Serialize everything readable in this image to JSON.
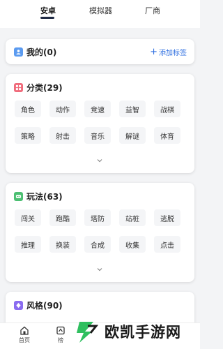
{
  "tabs": [
    {
      "label": "安卓"
    },
    {
      "label": "模拟器"
    },
    {
      "label": "厂商"
    }
  ],
  "mine": {
    "title": "我的(0)",
    "add_tag": "添加标签",
    "icon": "user-icon",
    "icon_color": "#5b9bf0"
  },
  "category": {
    "title": "分类(29)",
    "icon": "category-icon",
    "icon_color": "#f06b7b",
    "chips": [
      "角色",
      "动作",
      "竞速",
      "益智",
      "战棋",
      "策略",
      "射击",
      "音乐",
      "解谜",
      "体育"
    ]
  },
  "gameplay": {
    "title": "玩法(63)",
    "icon": "gameplay-icon",
    "icon_color": "#4cbf72",
    "chips": [
      "闯关",
      "跑酷",
      "塔防",
      "站桩",
      "逃脱",
      "推理",
      "换装",
      "合成",
      "收集",
      "点击"
    ]
  },
  "style": {
    "title": "风格(90)",
    "icon": "style-icon",
    "icon_color": "#8a6cf0"
  },
  "bottom_nav": [
    {
      "label": "首页"
    },
    {
      "label": "榜"
    }
  ],
  "watermark": {
    "text": "欧凯手游网"
  },
  "colors": {
    "accent": "#2f6fe0",
    "chip_bg": "#f4f5f7",
    "page_bg": "#f3f4f6"
  }
}
